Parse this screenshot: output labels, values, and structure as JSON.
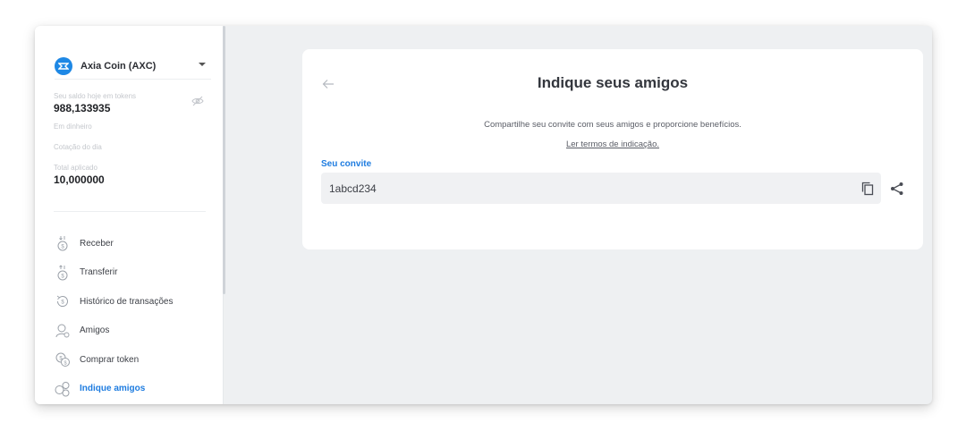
{
  "sidebar": {
    "coin": {
      "name": "Axia Coin (AXC)",
      "logo_color": "#1e88e5"
    },
    "balance_tokens": {
      "label": "Seu saldo hoje em tokens",
      "value": "988,133935"
    },
    "balance_cash": {
      "label": "Em dinheiro"
    },
    "quote": {
      "label": "Cotação do dia"
    },
    "total_applied": {
      "label": "Total aplicado",
      "value": "10,000000"
    },
    "menu": [
      {
        "label": "Receber",
        "icon": "receive-icon"
      },
      {
        "label": "Transferir",
        "icon": "transfer-icon"
      },
      {
        "label": "Histórico de transações",
        "icon": "history-icon"
      },
      {
        "label": "Amigos",
        "icon": "friends-icon"
      },
      {
        "label": "Comprar token",
        "icon": "buy-token-icon"
      },
      {
        "label": "Indique amigos",
        "icon": "refer-friends-icon",
        "active": true
      }
    ]
  },
  "card": {
    "title": "Indique seus amigos",
    "description": "Compartilhe seu convite com seus amigos e proporcione benefícios.",
    "terms_link": "Ler termos de indicação.",
    "invite_label": "Seu convite",
    "invite_code": "1abcd234"
  },
  "colors": {
    "accent": "#1e7ce0",
    "background": "#eef0f2",
    "card": "#ffffff"
  }
}
